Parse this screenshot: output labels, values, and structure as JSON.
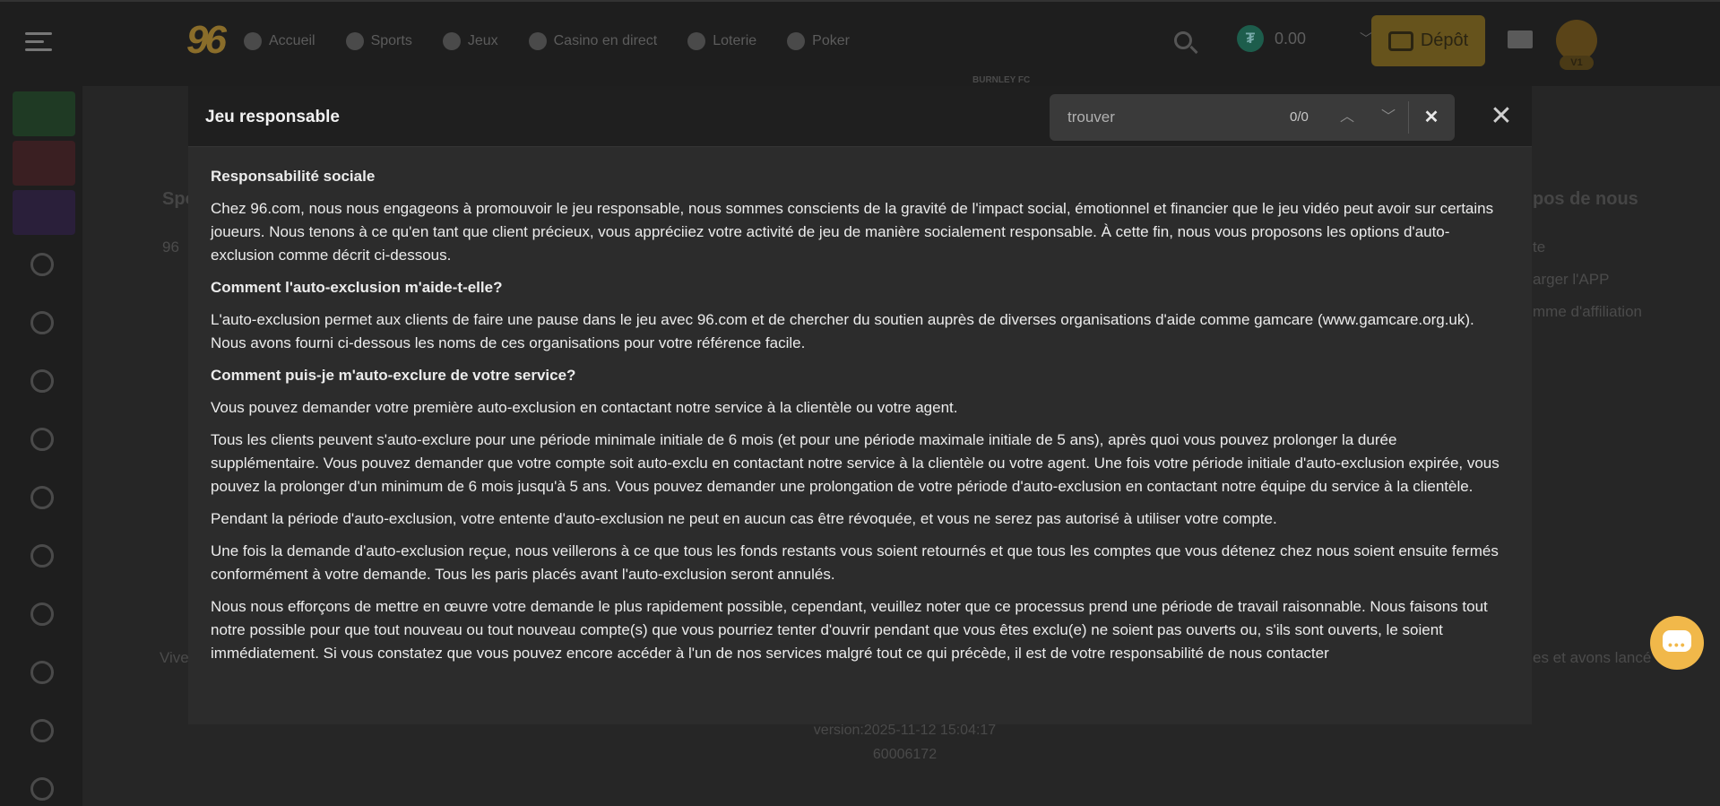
{
  "topbar": {
    "logo": "96",
    "nav": [
      {
        "label": "Accueil",
        "icon": "home-icon"
      },
      {
        "label": "Sports",
        "icon": "football-icon"
      },
      {
        "label": "Jeux",
        "icon": "joystick-icon"
      },
      {
        "label": "Casino en direct",
        "icon": "cards-icon"
      },
      {
        "label": "Loterie",
        "icon": "ticket-icon"
      },
      {
        "label": "Poker",
        "icon": "spade-icon"
      }
    ],
    "balance": "0.00",
    "currency_symbol": "₮",
    "deposit_label": "Dépôt",
    "vip_label": "V1"
  },
  "background": {
    "section_left": "Spo",
    "left_value": "96",
    "section_right": "pos de nous",
    "right_links": [
      "te",
      "arger l'APP",
      "mme d'affiliation"
    ],
    "footer_left": "Vive",
    "footer_right": "es et avons lancé",
    "version": "version:2025-11-12 15:04:17",
    "build": "60006172",
    "brand_partner": "BURNLEY FC"
  },
  "modal": {
    "title": "Jeu responsable",
    "find_placeholder": "trouver",
    "find_count": "0/0",
    "sections": [
      {
        "heading": "Responsabilité sociale"
      },
      {
        "text": "Chez 96.com, nous nous engageons à promouvoir le jeu responsable, nous sommes conscients de la gravité de l'impact social, émotionnel et financier que le jeu vidéo peut avoir sur certains joueurs. Nous tenons à ce qu'en tant que client précieux, vous appréciiez votre activité de jeu de manière socialement responsable. À cette fin, nous vous proposons les options d'auto-exclusion comme décrit ci-dessous."
      },
      {
        "heading": "Comment l'auto-exclusion m'aide-t-elle?"
      },
      {
        "text": "L'auto-exclusion permet aux clients de faire une pause dans le jeu avec 96.com et de chercher du soutien auprès de diverses organisations d'aide comme gamcare (www.gamcare.org.uk). Nous avons fourni ci-dessous les noms de ces organisations pour votre référence facile."
      },
      {
        "heading": "Comment puis-je m'auto-exclure de votre service?"
      },
      {
        "text": "Vous pouvez demander votre première auto-exclusion en contactant notre service à la clientèle ou votre agent."
      },
      {
        "text": "Tous les clients peuvent s'auto-exclure pour une période minimale initiale de 6 mois (et pour une période maximale initiale de 5 ans), après quoi vous pouvez prolonger la durée supplémentaire. Vous pouvez demander que votre compte soit auto-exclu en contactant notre service à la clientèle ou votre agent. Une fois votre période initiale d'auto-exclusion expirée, vous pouvez la prolonger d'un minimum de 6 mois jusqu'à 5 ans. Vous pouvez demander une prolongation de votre période d'auto-exclusion en contactant notre équipe du service à la clientèle."
      },
      {
        "text": "Pendant la période d'auto-exclusion, votre entente d'auto-exclusion ne peut en aucun cas être révoquée, et vous ne serez pas autorisé à utiliser votre compte."
      },
      {
        "text": "Une fois la demande d'auto-exclusion reçue, nous veillerons à ce que tous les fonds restants vous soient retournés et que tous les comptes que vous détenez chez nous soient ensuite fermés conformément à votre demande. Tous les paris placés avant l'auto-exclusion seront annulés."
      },
      {
        "text": "Nous nous efforçons de mettre en œuvre votre demande le plus rapidement possible, cependant, veuillez noter que ce processus prend une période de travail raisonnable. Nous faisons tout notre possible pour que tout nouveau ou tout nouveau compte(s) que vous pourriez tenter d'ouvrir pendant que vous êtes exclu(e) ne soient pas ouverts ou, s'ils sont ouverts, le soient immédiatement. Si vous constatez que vous pouvez encore accéder à l'un de nos services malgré tout ce qui précède, il est de votre responsabilité de nous contacter"
      }
    ]
  },
  "colors": {
    "accent": "#f1b84a",
    "overlay": "#262626",
    "modal_bg": "#2c2c2c"
  }
}
